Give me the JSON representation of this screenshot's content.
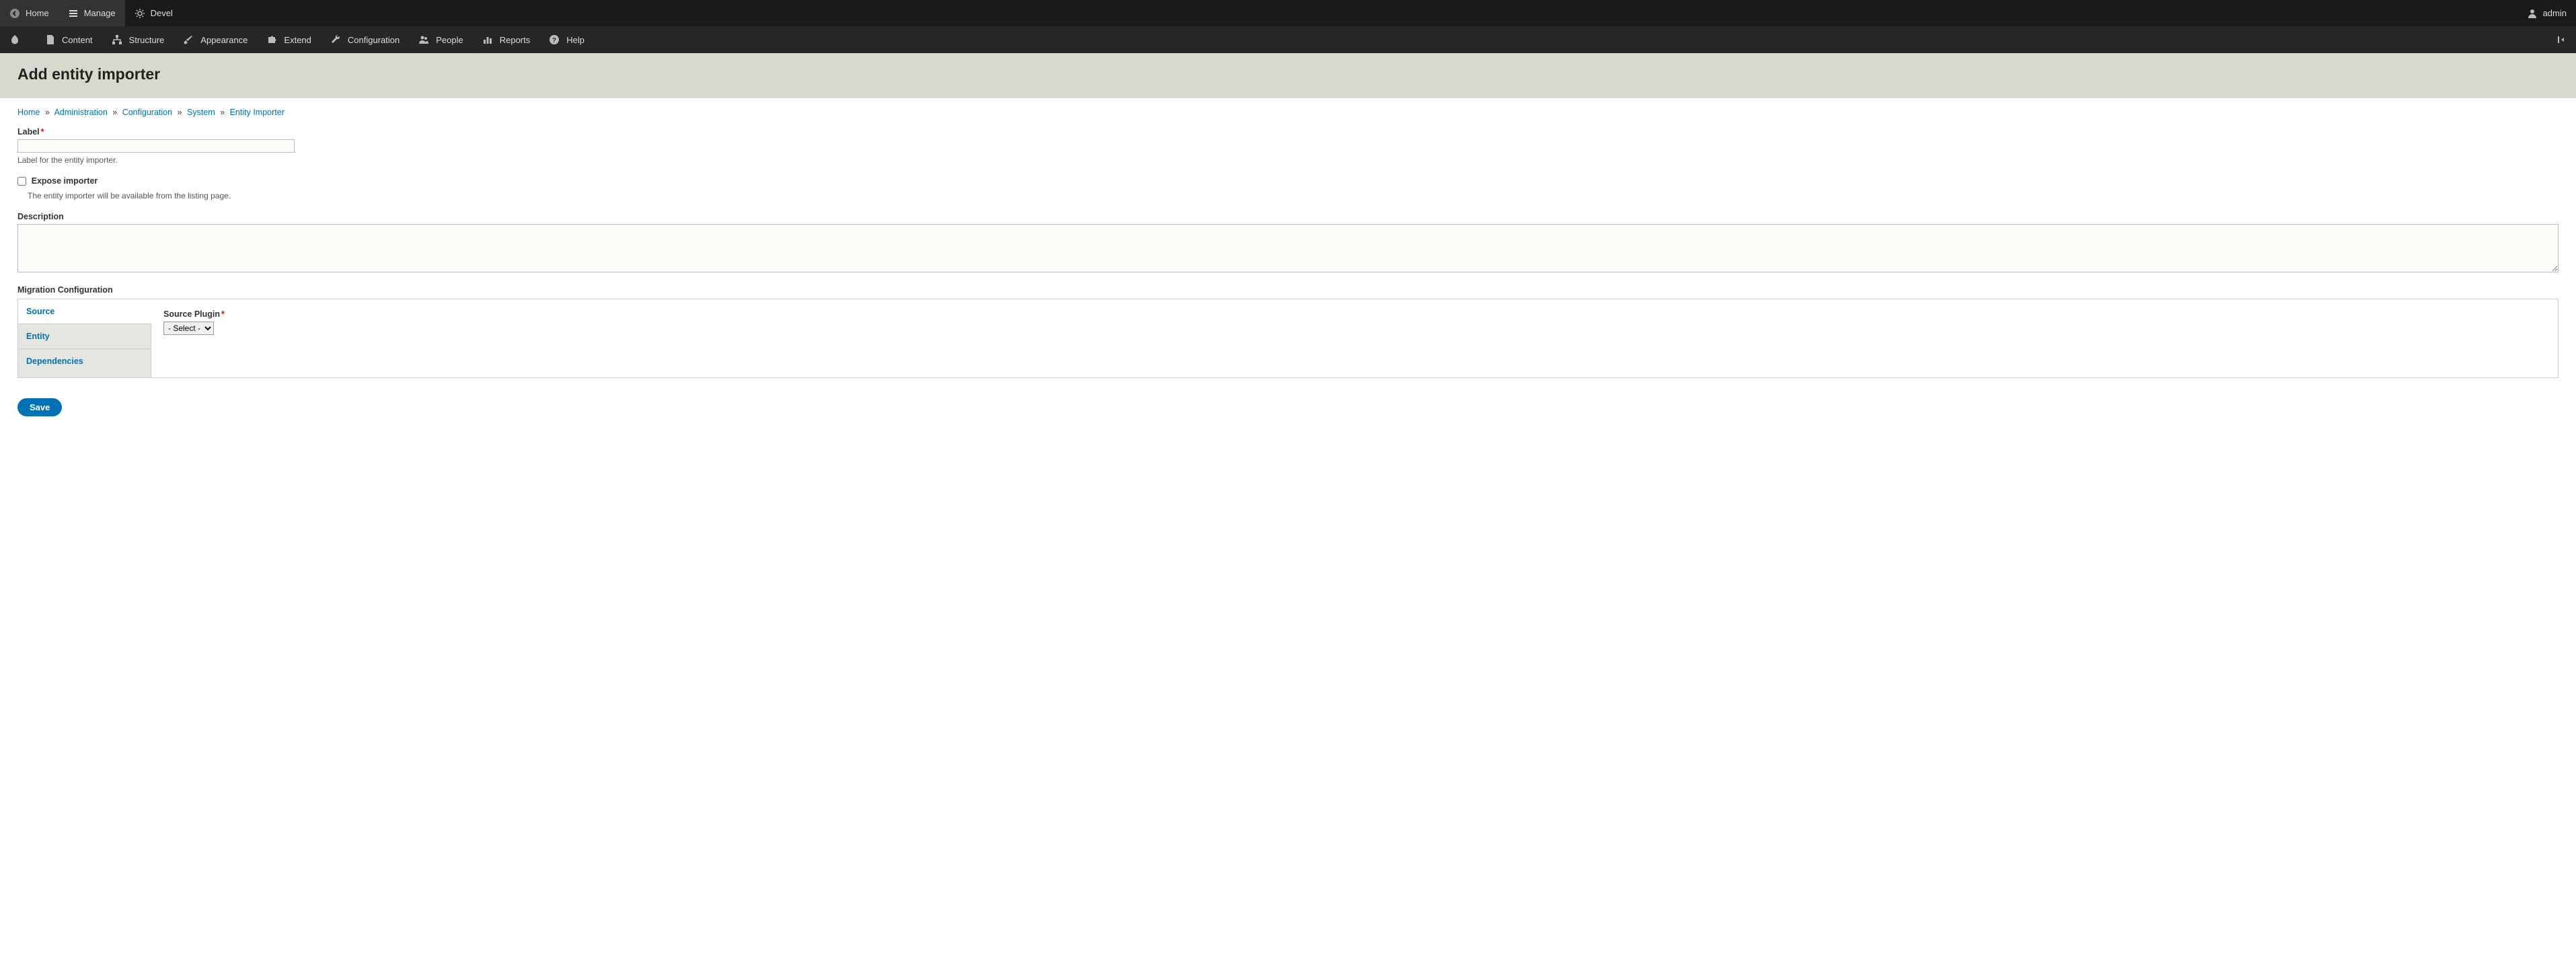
{
  "toolbar": {
    "home": "Home",
    "manage": "Manage",
    "devel": "Devel",
    "user": "admin"
  },
  "tray": {
    "content": "Content",
    "structure": "Structure",
    "appearance": "Appearance",
    "extend": "Extend",
    "configuration": "Configuration",
    "people": "People",
    "reports": "Reports",
    "help": "Help"
  },
  "page": {
    "title": "Add entity importer"
  },
  "breadcrumb": {
    "home": "Home",
    "administration": "Administration",
    "configuration": "Configuration",
    "system": "System",
    "entity_importer": "Entity Importer",
    "sep": "»"
  },
  "form": {
    "label": {
      "title": "Label",
      "value": "",
      "description": "Label for the entity importer."
    },
    "expose": {
      "title": "Expose importer",
      "checked": false,
      "description": "The entity importer will be available from the listing page."
    },
    "description": {
      "title": "Description",
      "value": ""
    },
    "migration": {
      "title": "Migration Configuration",
      "tabs": {
        "source": "Source",
        "entity": "Entity",
        "dependencies": "Dependencies"
      },
      "source": {
        "plugin_label": "Source Plugin",
        "select_placeholder": "- Select -"
      }
    },
    "save": "Save"
  }
}
